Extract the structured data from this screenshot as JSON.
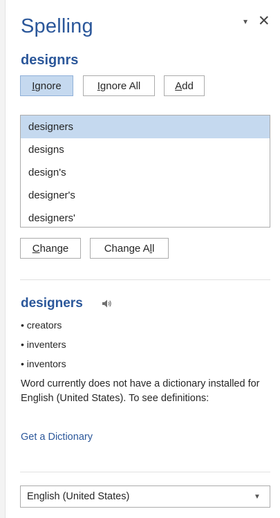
{
  "pane": {
    "title": "Spelling",
    "menu_glyph": "▾",
    "close_glyph": "✕"
  },
  "misspelled_word": "designrs",
  "buttons": {
    "ignore": {
      "mnemonic": "I",
      "rest": "gnore"
    },
    "ignore_all": {
      "mnemonic": "I",
      "rest": "gnore All"
    },
    "add": {
      "mnemonic": "A",
      "rest": "dd"
    },
    "change": {
      "mnemonic": "C",
      "rest": "hange"
    },
    "change_all": {
      "pre": "Change A",
      "mnemonic": "l",
      "rest": "l"
    }
  },
  "suggestions": [
    "designers",
    "designs",
    "design's",
    "designer's",
    "designers'"
  ],
  "selected_suggestion_index": 0,
  "definition": {
    "word": "designers",
    "synonyms": [
      "• creators",
      "• inventers",
      "• inventors"
    ],
    "note": "Word currently does not have a dictionary installed for English (United States). To see definitions:",
    "link": "Get a Dictionary"
  },
  "language": {
    "value": "English (United States)"
  },
  "colors": {
    "accent": "#2b579a",
    "selection": "#c5d9ef",
    "border": "#ababab"
  }
}
